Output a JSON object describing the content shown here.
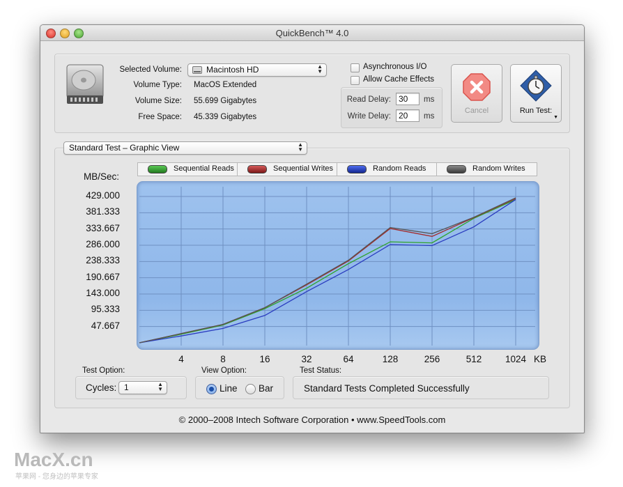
{
  "window": {
    "title": "QuickBench™ 4.0"
  },
  "volume": {
    "selected_label": "Selected Volume:",
    "selected_value": "Macintosh HD",
    "type_label": "Volume Type:",
    "type_value": "MacOS Extended",
    "size_label": "Volume Size:",
    "size_value": "55.699 Gigabytes",
    "free_label": "Free Space:",
    "free_value": "45.339 Gigabytes"
  },
  "options": {
    "async_label": "Asynchronous I/O",
    "async_checked": false,
    "cache_label": "Allow Cache Effects",
    "cache_checked": false,
    "read_delay_label": "Read Delay:",
    "read_delay_value": "30",
    "read_delay_unit": "ms",
    "write_delay_label": "Write Delay:",
    "write_delay_value": "20",
    "write_delay_unit": "ms"
  },
  "buttons": {
    "cancel_label": "Cancel",
    "run_test_label": "Run Test"
  },
  "view_popup": {
    "value": "Standard Test – Graphic View"
  },
  "legend": [
    {
      "label": "Sequential Reads",
      "color": "#2e9a2a"
    },
    {
      "label": "Sequential Writes",
      "color": "#a32a2a"
    },
    {
      "label": "Random Reads",
      "color": "#1f3cb8"
    },
    {
      "label": "Random Writes",
      "color": "#5a5a5a"
    }
  ],
  "chart_data": {
    "type": "line",
    "ylabel": "MB/Sec:",
    "xlabel": "KB",
    "y_ticks": [
      "429.000",
      "381.333",
      "333.667",
      "286.000",
      "238.333",
      "190.667",
      "143.000",
      "95.333",
      "47.667"
    ],
    "x_ticks": [
      "4",
      "8",
      "16",
      "32",
      "64",
      "128",
      "256",
      "512",
      "1024"
    ],
    "ylim": [
      0,
      476.667
    ],
    "grid": true,
    "series": [
      {
        "name": "Sequential Reads",
        "color": "#2ea32a",
        "values": [
          0,
          25,
          52,
          100,
          160,
          232,
          296,
          293,
          365,
          420
        ]
      },
      {
        "name": "Sequential Writes",
        "color": "#a32a2a",
        "values": [
          0,
          27,
          54,
          103,
          170,
          240,
          335,
          312,
          367,
          423
        ]
      },
      {
        "name": "Random Reads",
        "color": "#2a3cbf",
        "values": [
          0,
          20,
          42,
          80,
          150,
          215,
          288,
          285,
          340,
          420
        ]
      },
      {
        "name": "Random Writes",
        "color": "#555555",
        "values": [
          0,
          27,
          54,
          103,
          172,
          242,
          338,
          320,
          368,
          425
        ]
      }
    ]
  },
  "test_option": {
    "label": "Test Option:",
    "cycles_label": "Cycles:",
    "cycles_value": "1"
  },
  "view_option": {
    "label": "View Option:",
    "line_label": "Line",
    "bar_label": "Bar",
    "selected": "Line"
  },
  "test_status": {
    "label": "Test Status:",
    "value": "Standard Tests Completed Successfully"
  },
  "footer": {
    "copyright": "© 2000–2008 Intech Software Corporation • www.SpeedTools.com"
  },
  "watermark": {
    "brand": "MacX.cn",
    "tagline": "苹果网 - 您身边的苹果专家"
  }
}
